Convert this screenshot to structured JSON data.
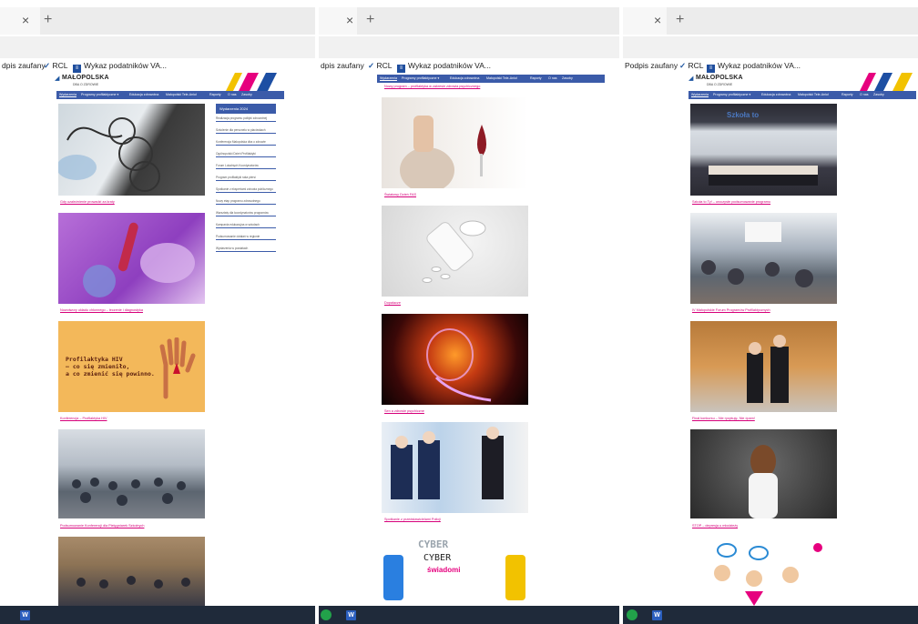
{
  "browser": {
    "close_glyph": "×",
    "new_tab_glyph": "+",
    "bookmarks_pane1": [
      "dpis zaufany",
      "RCL",
      "Wykaz podatników VA..."
    ],
    "bookmarks_pane2": [
      "dpis zaufany",
      "RCL",
      "Wykaz podatników VA..."
    ],
    "bookmarks_pane3": [
      "Podpis zaufany",
      "RCL",
      "Wykaz podatników VA..."
    ]
  },
  "site": {
    "logo": "MAŁOPOLSKA",
    "logo_sub": "DBA O ZDROWIE",
    "nav": [
      "Wydarzenia",
      "Programy profilaktyczne ▾",
      "Edukacja zdrowotna",
      "Małopolski Tele-Anioł",
      "Raporty",
      "O nas",
      "Zasoby"
    ],
    "brand_colors": {
      "nav": "#3b5ba9",
      "link": "#d6007a",
      "stripe_pink": "#e6007e",
      "stripe_blue": "#1d4fa3",
      "stripe_yellow": "#f2c200"
    }
  },
  "sidebar": {
    "title": "Wydarzenia 2024",
    "items": [
      "Realizacja programu polityki zdrowotnej",
      "Szkolenie dla personelu w placówkach",
      "Konferencja Małopolska dba o zdrowie",
      "Ogólnopolski Dzień Profilaktyki",
      "Forum Lokalnych Koordynatorów",
      "Program profilaktyki raka piersi",
      "Spotkanie z ekspertami zdrowia publicznego",
      "Nowy etap programu zdrowotnego",
      "Warsztaty dla koordynatorów programów",
      "Kampania edukacyjna w szkołach",
      "Podsumowanie działań w regionie",
      "Wydarzenia w powiatach"
    ]
  },
  "pane1": {
    "top_caption": "",
    "posts": [
      {
        "caption": "Gdy uzależnienie prowadzi za kraty",
        "thumb": "barbed-wire"
      },
      {
        "caption": "Nowotwory układu chłonnego – leczenie i diagnostyka",
        "thumb": "virus-lab"
      },
      {
        "caption": "Konferencja – Profilaktyka HIV",
        "thumb": "hiv-poster",
        "poster_lines": [
          "Profilaktyka HIV",
          "– co się zmieniło,",
          "a co zmienić się powinno."
        ]
      },
      {
        "caption": "Podsumowanie Konferencji dla Pielęgniarek Szkolnych",
        "thumb": "conference-hall"
      },
      {
        "caption": "",
        "thumb": "lecture-room"
      }
    ]
  },
  "pane2": {
    "top_caption": "Nowy program – profilaktyka w zakresie zdrowia psychicznego",
    "posts": [
      {
        "caption": "Światowy Dzień FAS",
        "thumb": "pregnancy-alcohol"
      },
      {
        "caption": "Dopalacze",
        "thumb": "pills"
      },
      {
        "caption": "Sen a zdrowie psychiczne",
        "thumb": "brain-xray"
      },
      {
        "caption": "Spotkanie z przedstawicielami Policji",
        "thumb": "officers"
      },
      {
        "caption": "",
        "thumb": "cyber",
        "poster_lines": [
          "CYBER",
          "CYBER",
          "świadomi"
        ]
      }
    ]
  },
  "pane3": {
    "top_caption": "",
    "posts": [
      {
        "caption": "Szkoła to Ty! – uroczyste podsumowanie programu",
        "thumb": "stage-group",
        "poster_lines": [
          "Szkoła to"
        ]
      },
      {
        "caption": "IV Małopolskie Forum Programów Profilaktycznych",
        "thumb": "audience"
      },
      {
        "caption": "Finał konkursu – Nie ryzykuję, Nie ćpam!",
        "thumb": "award-pair"
      },
      {
        "caption": "STOP – depresja u młodzieży",
        "thumb": "sad-girl"
      },
      {
        "caption": "",
        "thumb": "kids-cartoon"
      }
    ]
  }
}
